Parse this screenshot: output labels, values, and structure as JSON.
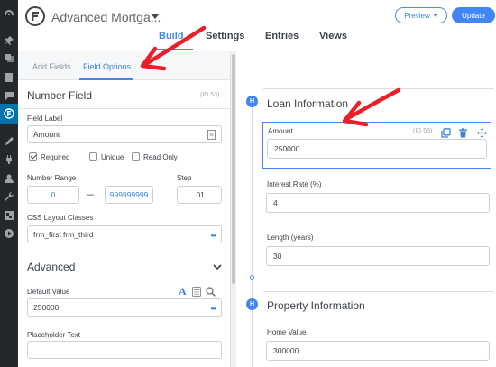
{
  "header": {
    "form_title": "Advanced Mortga...",
    "preview_label": "Preview",
    "update_label": "Update",
    "tabs": [
      {
        "label": "Build",
        "active": true
      },
      {
        "label": "Settings"
      },
      {
        "label": "Entries"
      },
      {
        "label": "Views"
      }
    ]
  },
  "sidebar": {
    "icons": [
      "dashboard-icon",
      "pin-icon",
      "media-icon",
      "pages-icon",
      "comments-icon",
      "formidable-icon",
      "appearance-icon",
      "plugins-icon",
      "users-icon",
      "tools-icon",
      "settings-icon",
      "play-icon"
    ]
  },
  "panel": {
    "tabs": {
      "add_fields": "Add Fields",
      "field_options": "Field Options"
    },
    "section_title": "Number Field",
    "field_id": "(ID 53)",
    "field_label": {
      "label": "Field Label",
      "value": "Amount"
    },
    "checkboxes": [
      {
        "label": "Required",
        "checked": true
      },
      {
        "label": "Unique",
        "checked": false
      },
      {
        "label": "Read Only",
        "checked": false
      }
    ],
    "number_range": {
      "label": "Number Range",
      "min": "0",
      "separator": "–",
      "max": "999999999"
    },
    "step": {
      "label": "Step",
      "value": ".01"
    },
    "css_classes": {
      "label": "CSS Layout Classes",
      "value": "frm_first frm_third"
    },
    "advanced": {
      "title": "Advanced"
    },
    "default_value": {
      "label": "Default Value",
      "value": "250000"
    },
    "placeholder": {
      "label": "Placeholder Text",
      "value": ""
    }
  },
  "canvas": {
    "sections": [
      {
        "marker": "H",
        "title": "Loan Information",
        "fields": [
          {
            "label": "Amount",
            "id": "(ID 53)",
            "value": "250000",
            "selected": true
          },
          {
            "label": "Interest Rate (%)",
            "value": "4"
          },
          {
            "label": "Length (years)",
            "value": "30"
          }
        ]
      },
      {
        "marker": "H",
        "title": "Property Information",
        "fields": [
          {
            "label": "Home Value",
            "value": "300000"
          }
        ]
      }
    ]
  },
  "colors": {
    "accent": "#4286f4",
    "annotation_red": "#e8202a",
    "wp_sidebar": "#23282d"
  }
}
